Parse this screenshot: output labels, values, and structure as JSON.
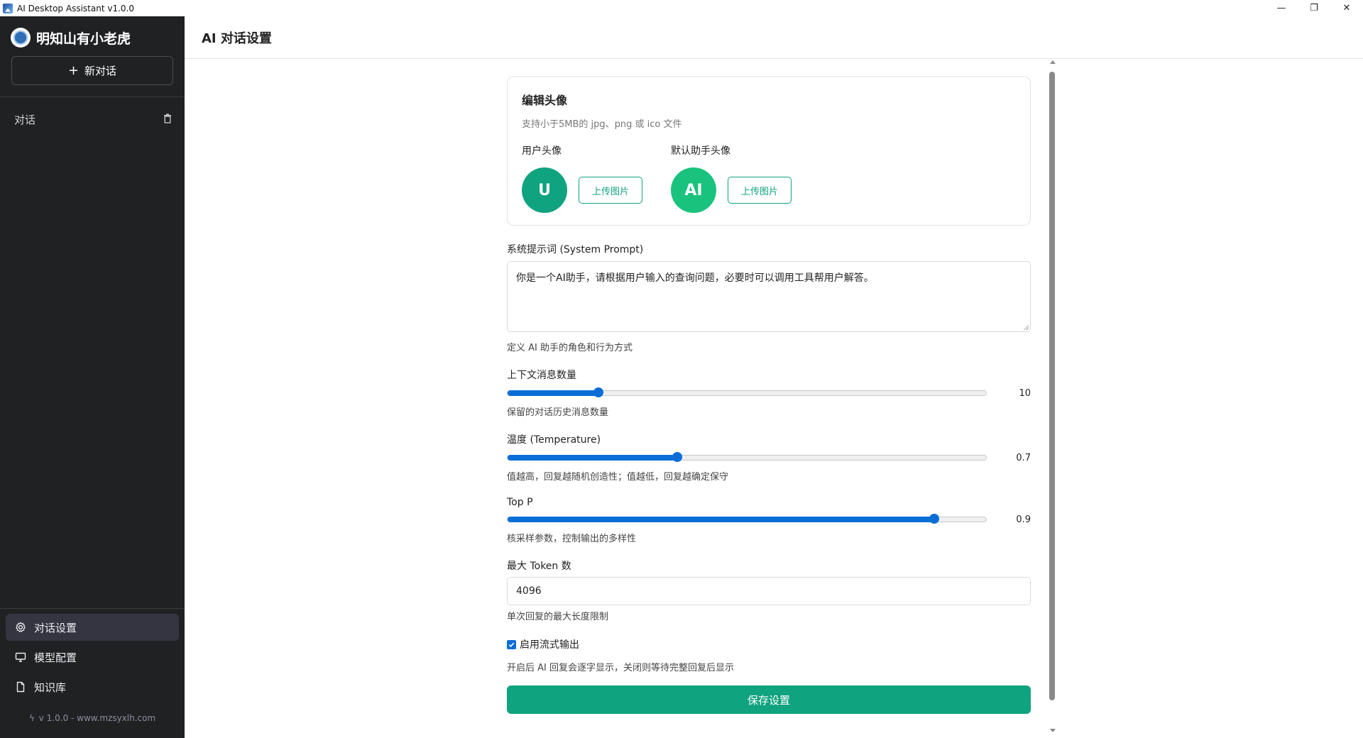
{
  "window": {
    "title": "AI Desktop Assistant v1.0.0",
    "controls": {
      "minimize": "—",
      "restore": "❐",
      "close": "✕"
    }
  },
  "sidebar": {
    "brand": "明知山有小老虎",
    "new_chat": "新对话",
    "conversations_heading": "对话",
    "nav": [
      {
        "label": "对话设置",
        "icon": "gear-icon",
        "active": true
      },
      {
        "label": "模型配置",
        "icon": "monitor-icon",
        "active": false
      },
      {
        "label": "知识库",
        "icon": "document-icon",
        "active": false
      }
    ],
    "footer": "v 1.0.0  -  www.mzsyxlh.com"
  },
  "header": {
    "title": "AI 对话设置"
  },
  "avatar_card": {
    "title": "编辑头像",
    "subtitle": "支持小于5MB的 jpg、png 或 ico 文件",
    "user": {
      "label": "用户头像",
      "initial": "U",
      "color": "#10a37f",
      "button": "上传图片"
    },
    "assistant": {
      "label": "默认助手头像",
      "initial": "AI",
      "color": "#19c37d",
      "button": "上传图片"
    }
  },
  "system_prompt": {
    "label": "系统提示词 (System Prompt)",
    "value": "你是一个AI助手，请根据用户输入的查询问题，必要时可以调用工具帮用户解答。",
    "hint": "定义 AI 助手的角色和行为方式"
  },
  "context_count": {
    "label": "上下文消息数量",
    "value": "10",
    "fraction": 0.19,
    "hint": "保留的对话历史消息数量"
  },
  "temperature": {
    "label": "温度 (Temperature)",
    "value": "0.7",
    "fraction": 0.355,
    "hint": "值越高，回复越随机创造性；值越低，回复越确定保守"
  },
  "top_p": {
    "label": "Top P",
    "value": "0.9",
    "fraction": 0.892,
    "hint": "核采样参数，控制输出的多样性"
  },
  "max_tokens": {
    "label": "最大 Token 数",
    "value": "4096",
    "hint": "单次回复的最大长度限制"
  },
  "streaming": {
    "label": "启用流式输出",
    "checked": true,
    "hint": "开启后 AI 回复会逐字显示，关闭则等待完整回复后显示"
  },
  "save_button": "保存设置",
  "colors": {
    "accent": "#10a37f",
    "slider": "#0b6ed8",
    "sidebar_bg": "#202123"
  }
}
